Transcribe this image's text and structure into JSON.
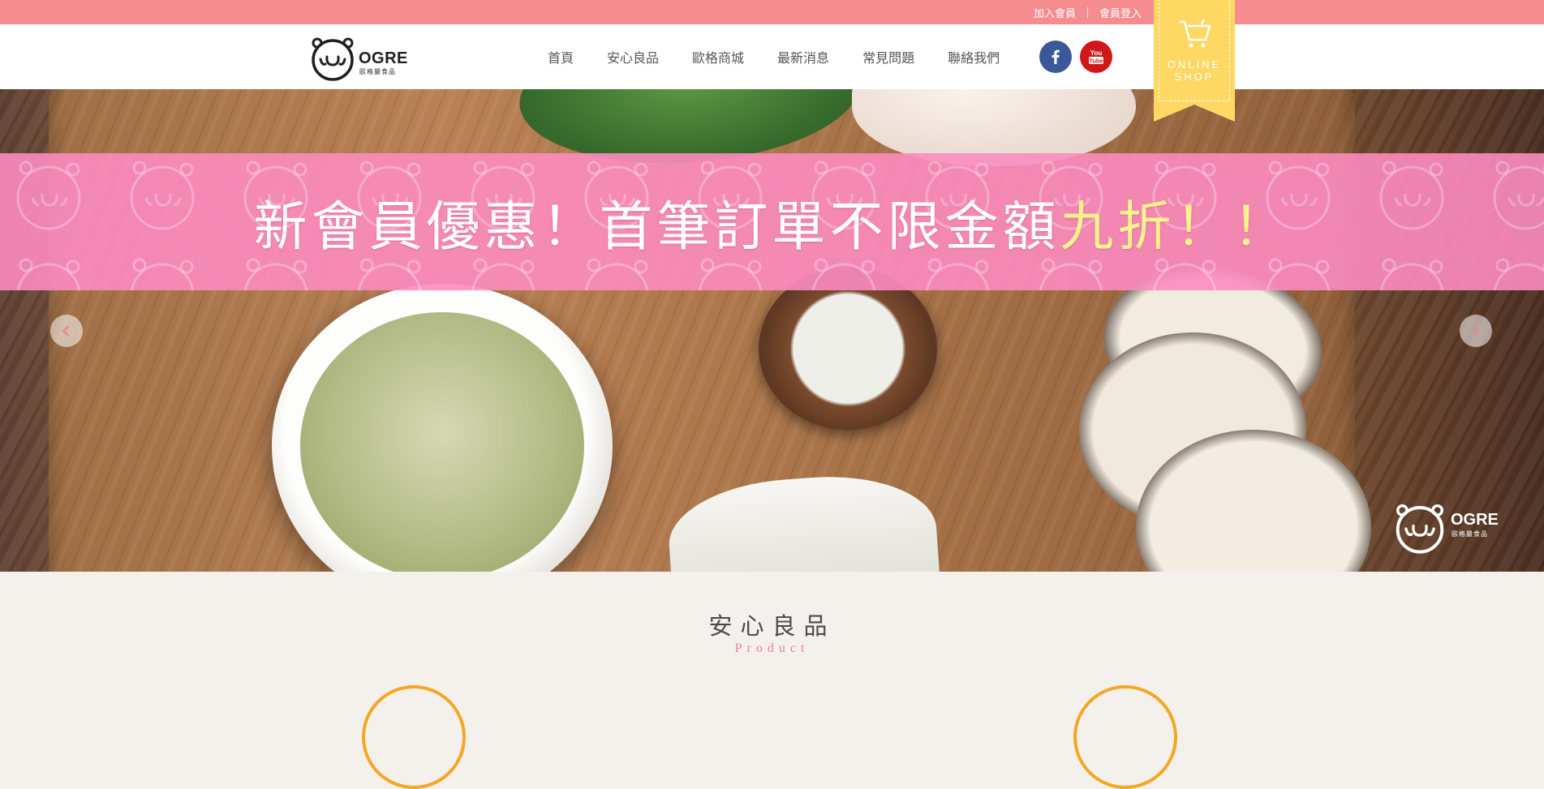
{
  "topbar": {
    "links": [
      {
        "label": "加入會員"
      },
      {
        "label": "會員登入"
      }
    ]
  },
  "header": {
    "logo": {
      "word": "OGRE",
      "sub": "歐格嚴食品"
    },
    "nav": [
      {
        "label": "首頁"
      },
      {
        "label": "安心良品"
      },
      {
        "label": "歐格商城"
      },
      {
        "label": "最新消息"
      },
      {
        "label": "常見問題"
      },
      {
        "label": "聯絡我們"
      }
    ],
    "social": [
      {
        "icon": "facebook-icon"
      },
      {
        "icon": "youtube-icon",
        "text": "You Tube"
      }
    ],
    "online_shop": {
      "line1": "ONLINE",
      "line2": "SHOP",
      "icon": "cart-icon"
    }
  },
  "hero": {
    "promo": {
      "text": "新會員優惠！首筆訂單不限金額",
      "highlight": "九折！！"
    },
    "watermark": {
      "word": "OGRE",
      "sub": "歐格嚴食品"
    },
    "arrows": {
      "prev": "chevron-left-icon",
      "next": "chevron-right-icon"
    }
  },
  "section": {
    "title": "安心良品",
    "subtitle": "Product"
  },
  "colors": {
    "topbar": "#f58c8f",
    "promo_band": "#fc8cbe",
    "highlight": "#fff38e",
    "ribbon": "#fed863",
    "facebook": "#3b5998",
    "youtube": "#d0181b",
    "subtitle": "#f07f8a"
  }
}
